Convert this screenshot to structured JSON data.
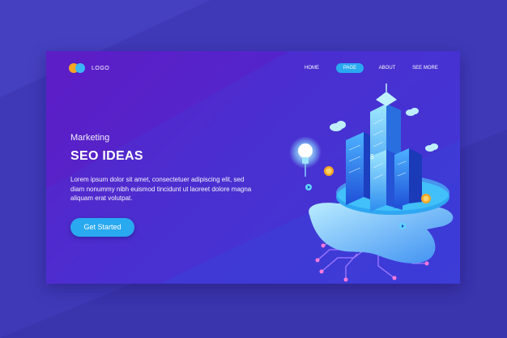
{
  "logo": {
    "text": "LOGO",
    "colors": [
      "#f5a623",
      "#39b7f4"
    ]
  },
  "nav": {
    "items": [
      {
        "label": "HOME",
        "active": false
      },
      {
        "label": "PAGE",
        "active": true
      },
      {
        "label": "ABOUT",
        "active": false
      },
      {
        "label": "SEE MORE",
        "active": false
      }
    ]
  },
  "hero": {
    "eyebrow": "Marketing",
    "title": "SEO IDEAS",
    "body": "Lorem ipsum dolor sit amet, consectetuer adipiscing elit, sed diam nonummy nibh euismod tincidunt ut laoreet dolore magna aliquam erat volutpat.",
    "cta": "Get Started"
  },
  "theme": {
    "background": "#3f39b8",
    "card": "#4a2fd0",
    "accent": "#29a9f0"
  },
  "illustration": {
    "icons": [
      "city-skyscrapers-icon",
      "lightbulb-icon",
      "coin-icon",
      "cloud-icon",
      "circuit-icon",
      "play-icon"
    ]
  }
}
